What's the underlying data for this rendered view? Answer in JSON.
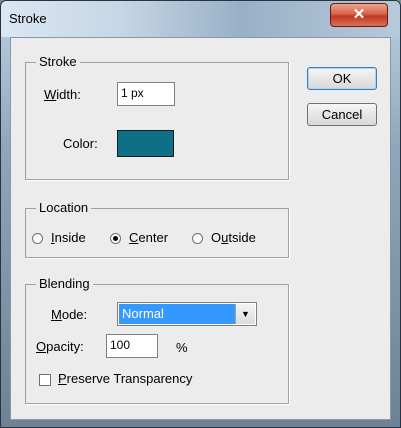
{
  "window": {
    "title": "Stroke",
    "close_icon": "close-icon"
  },
  "stroke": {
    "legend": "Stroke",
    "width_label_prefix": "W",
    "width_label_rest": "idth:",
    "width_value": "1 px",
    "color_label": "Color:",
    "color_value": "#0f6f86"
  },
  "location": {
    "legend": "Location",
    "options": [
      {
        "accel": "I",
        "rest": "nside",
        "selected": false
      },
      {
        "accel": "C",
        "rest": "enter",
        "selected": true
      },
      {
        "pre": "O",
        "accel": "u",
        "rest": "tside",
        "selected": false
      }
    ]
  },
  "blending": {
    "legend": "Blending",
    "mode_label_accel": "M",
    "mode_label_rest": "ode:",
    "mode_value": "Normal",
    "opacity_label_accel": "O",
    "opacity_label_rest": "pacity:",
    "opacity_value": "100",
    "opacity_unit": "%",
    "preserve_accel": "P",
    "preserve_rest": "reserve Transparency",
    "preserve_checked": false
  },
  "buttons": {
    "ok": "OK",
    "cancel": "Cancel"
  }
}
